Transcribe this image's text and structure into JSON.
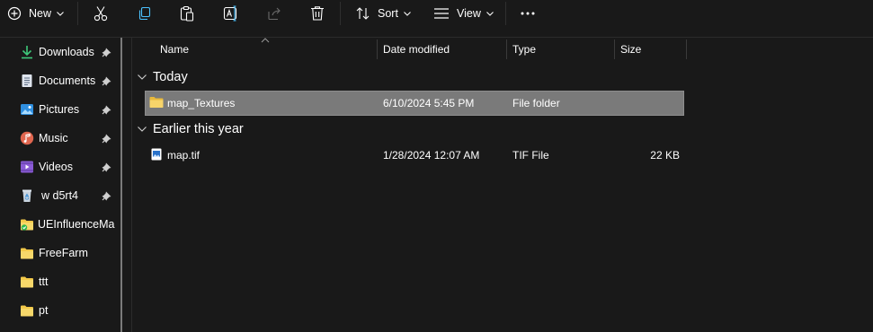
{
  "toolbar": {
    "new_label": "New",
    "sort_label": "Sort",
    "view_label": "View",
    "icons": [
      "plus-circle-icon",
      "cut-icon",
      "copy-icon",
      "paste-icon",
      "rename-icon",
      "share-icon",
      "delete-icon",
      "sort-icon",
      "view-icon",
      "more-icon"
    ]
  },
  "sidebar": {
    "items": [
      {
        "label": "Downloads",
        "icon": "download-icon",
        "pinned": true
      },
      {
        "label": "Documents",
        "icon": "document-icon",
        "pinned": true
      },
      {
        "label": "Pictures",
        "icon": "pictures-icon",
        "pinned": true
      },
      {
        "label": "Music",
        "icon": "music-icon",
        "pinned": true
      },
      {
        "label": "Videos",
        "icon": "videos-icon",
        "pinned": true
      },
      {
        "label": "w d5rt4",
        "icon": "recycle-icon",
        "pinned": true
      },
      {
        "label": "UEInfluenceMap",
        "icon": "folder-icon",
        "pinned": false
      },
      {
        "label": "FreeFarm",
        "icon": "folder-icon",
        "pinned": false
      },
      {
        "label": "ttt",
        "icon": "folder-icon",
        "pinned": false
      },
      {
        "label": "pt",
        "icon": "folder-icon",
        "pinned": false
      }
    ]
  },
  "columns": {
    "name": "Name",
    "date_modified": "Date modified",
    "type": "Type",
    "size": "Size"
  },
  "groups": [
    {
      "label": "Today",
      "files": [
        {
          "name": "map_Textures",
          "date": "6/10/2024 5:45 PM",
          "type": "File folder",
          "size": "",
          "icon": "folder-icon",
          "selected": true
        }
      ]
    },
    {
      "label": "Earlier this year",
      "files": [
        {
          "name": "map.tif",
          "date": "1/28/2024 12:07 AM",
          "type": "TIF File",
          "size": "22 KB",
          "icon": "image-file-icon",
          "selected": false
        }
      ]
    }
  ],
  "colors": {
    "background": "#191919",
    "selection": "#7a7a7a",
    "folder": "#f3c94a",
    "accent": "#4cc2ff"
  }
}
